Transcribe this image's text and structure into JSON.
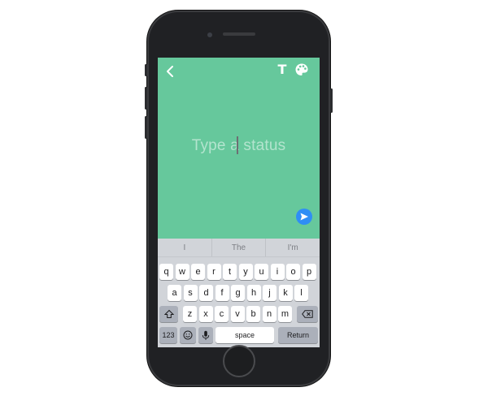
{
  "status_composer": {
    "placeholder": "Type a status",
    "background_color": "#66c89c",
    "accent_color": "#2f8ef5"
  },
  "toolbar": {
    "back_icon": "chevron-left-icon",
    "text_style_label": "T",
    "palette_icon": "palette-icon",
    "send_icon": "send-arrow-icon"
  },
  "predictive_bar": [
    "I",
    "The",
    "I'm"
  ],
  "keyboard": {
    "row1": [
      "q",
      "w",
      "e",
      "r",
      "t",
      "y",
      "u",
      "i",
      "o",
      "p"
    ],
    "row2": [
      "a",
      "s",
      "d",
      "f",
      "g",
      "h",
      "j",
      "k",
      "l"
    ],
    "row3": [
      "z",
      "x",
      "c",
      "v",
      "b",
      "n",
      "m"
    ],
    "shift_icon": "shift-icon",
    "delete_icon": "backspace-icon",
    "numbers_label": "123",
    "emoji_icon": "emoji-icon",
    "mic_icon": "microphone-icon",
    "space_label": "space",
    "return_label": "Return"
  }
}
